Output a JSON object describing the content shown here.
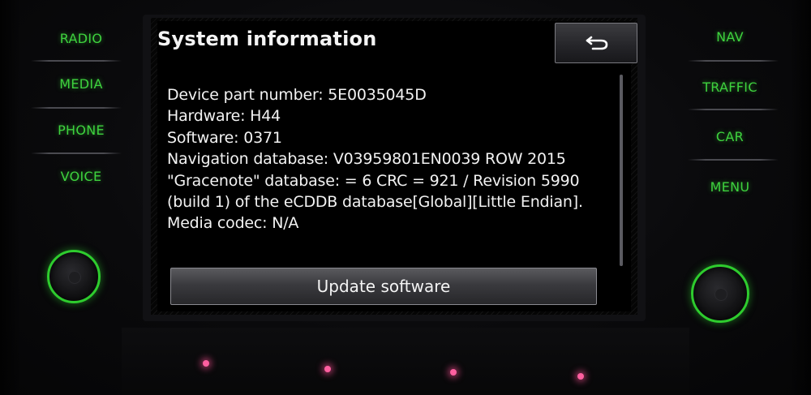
{
  "left_keys": [
    {
      "label": "RADIO"
    },
    {
      "label": "MEDIA"
    },
    {
      "label": "PHONE"
    },
    {
      "label": "VOICE"
    }
  ],
  "right_keys": [
    {
      "label": "NAV"
    },
    {
      "label": "TRAFFIC"
    },
    {
      "label": "CAR"
    },
    {
      "label": "MENU"
    }
  ],
  "screen": {
    "title": "System information",
    "back_icon": "return-arrow-icon",
    "info_lines": [
      "Device part number: 5E0035045D",
      "Hardware: H44",
      "Software: 0371",
      "Navigation database: V03959801EN0039 ROW 2015",
      "\"Gracenote\" database: = 6 CRC = 921  / Revision 5990",
      "(build 1) of the eCDDB database[Global][Little Endian].",
      "Media codec: N/A"
    ],
    "update_button_label": "Update software"
  },
  "colors": {
    "hardkey_green": "#3ed23e",
    "knob_ring": "#2ecc2e",
    "led_pink": "#ff5fa0",
    "screen_bg": "#000000",
    "text": "#f2f2f2"
  }
}
